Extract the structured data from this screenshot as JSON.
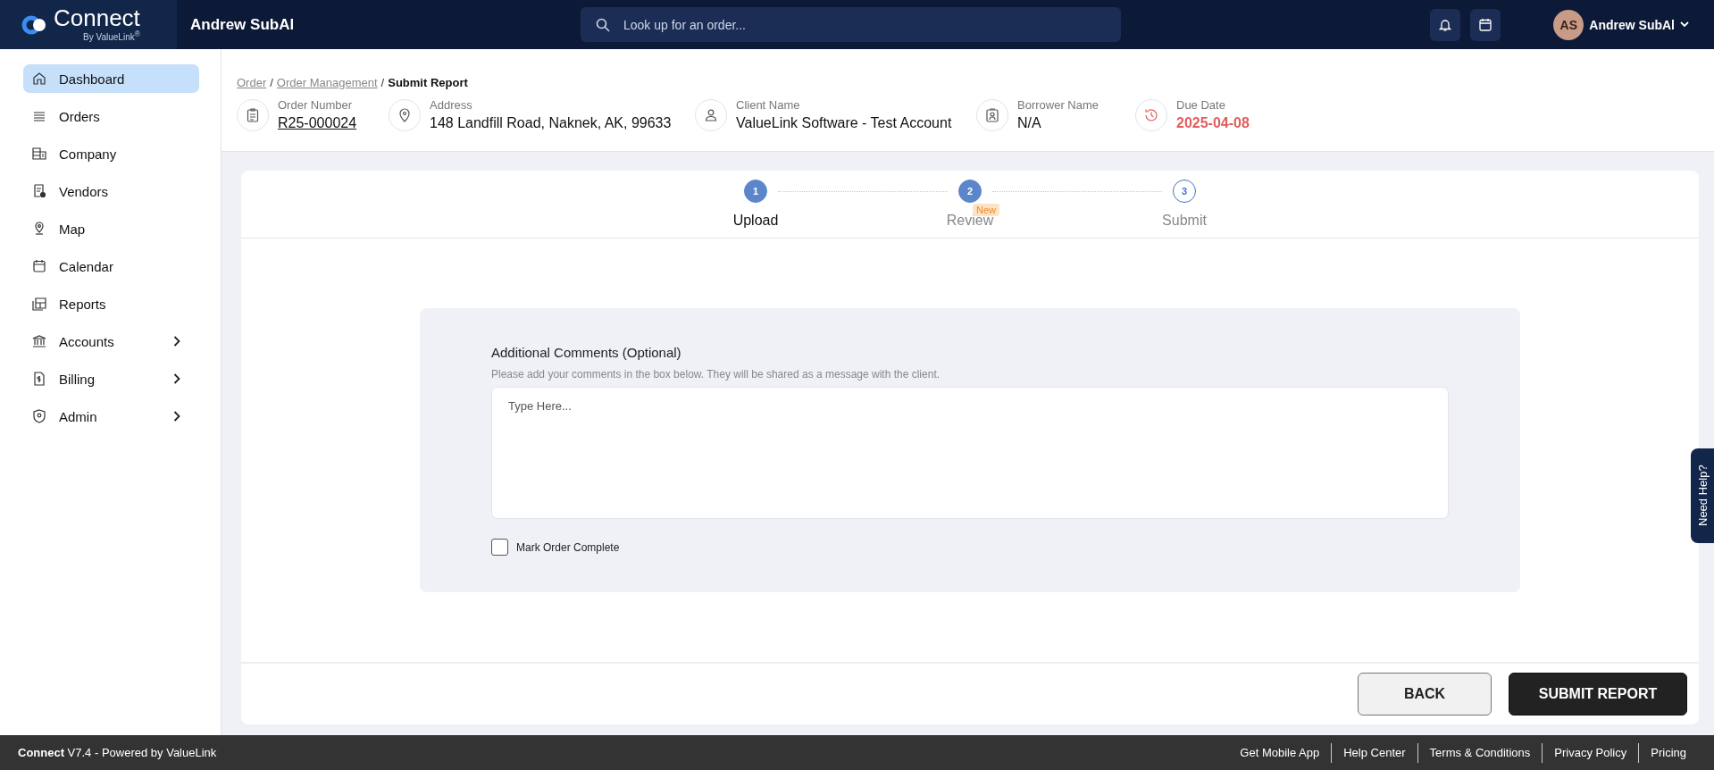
{
  "topbar": {
    "logo": {
      "name": "Connect",
      "tagline": "By ValueLink$^{®}$"
    },
    "company": "Andrew SubAl",
    "search": {
      "placeholder": "Look up for an order..."
    },
    "user": {
      "initials": "AS",
      "name": "Andrew SubAl"
    }
  },
  "sidebar": {
    "items": [
      {
        "label": "Dashboard",
        "selected": true,
        "expandable": false
      },
      {
        "label": "Orders",
        "selected": false,
        "expandable": false
      },
      {
        "label": "Company",
        "selected": false,
        "expandable": false
      },
      {
        "label": "Vendors",
        "selected": false,
        "expandable": false
      },
      {
        "label": "Map",
        "selected": false,
        "expandable": false
      },
      {
        "label": "Calendar",
        "selected": false,
        "expandable": false
      },
      {
        "label": "Reports",
        "selected": false,
        "expandable": false
      },
      {
        "label": "Accounts",
        "selected": false,
        "expandable": true
      },
      {
        "label": "Billing",
        "selected": false,
        "expandable": true
      },
      {
        "label": "Admin",
        "selected": false,
        "expandable": true
      }
    ]
  },
  "breadcrumb": [
    {
      "label": "Order",
      "kind": "link"
    },
    {
      "label": "/",
      "kind": "separator"
    },
    {
      "label": "Order Management",
      "kind": "link"
    },
    {
      "label": "/",
      "kind": "separator"
    },
    {
      "label": "Submit Report",
      "kind": "current"
    }
  ],
  "order_info": [
    {
      "label": "Order Number",
      "value": "R25-000024",
      "kind": "link"
    },
    {
      "label": "Address",
      "value": "148 Landfill Road, Naknek, AK, 99633",
      "kind": "text"
    },
    {
      "label": "Client Name",
      "value": "ValueLink Software - Test Account",
      "kind": "text"
    },
    {
      "label": "Borrower Name",
      "value": "N/A",
      "kind": "text"
    },
    {
      "label": "Due Date",
      "value": "2025-04-08",
      "kind": "due"
    }
  ],
  "steps": [
    {
      "number": "1",
      "label": "Upload",
      "filled": true,
      "selected": true
    },
    {
      "number": "2",
      "label": "Review",
      "filled": true,
      "selected": false,
      "badge": "New"
    },
    {
      "number": "3",
      "label": "Submit",
      "filled": false,
      "selected": false
    }
  ],
  "comments": {
    "title": "Additional Comments (Optional)",
    "hint": "Please add your comments in the box below. They will be shared as a message with the client.",
    "placeholder": "Type Here...",
    "mark_complete": {
      "label": "Mark Order Complete",
      "checked": false
    }
  },
  "buttons": {
    "back": "BACK",
    "submit": "SUBMIT REPORT"
  },
  "help_tab": "Need Help?",
  "footer": {
    "version": "**Connect** V7.4 - Powered by ValueLink",
    "links": [
      "Get Mobile App",
      "Help Center",
      "Terms & Conditions",
      "Privacy Policy",
      "Pricing"
    ]
  }
}
